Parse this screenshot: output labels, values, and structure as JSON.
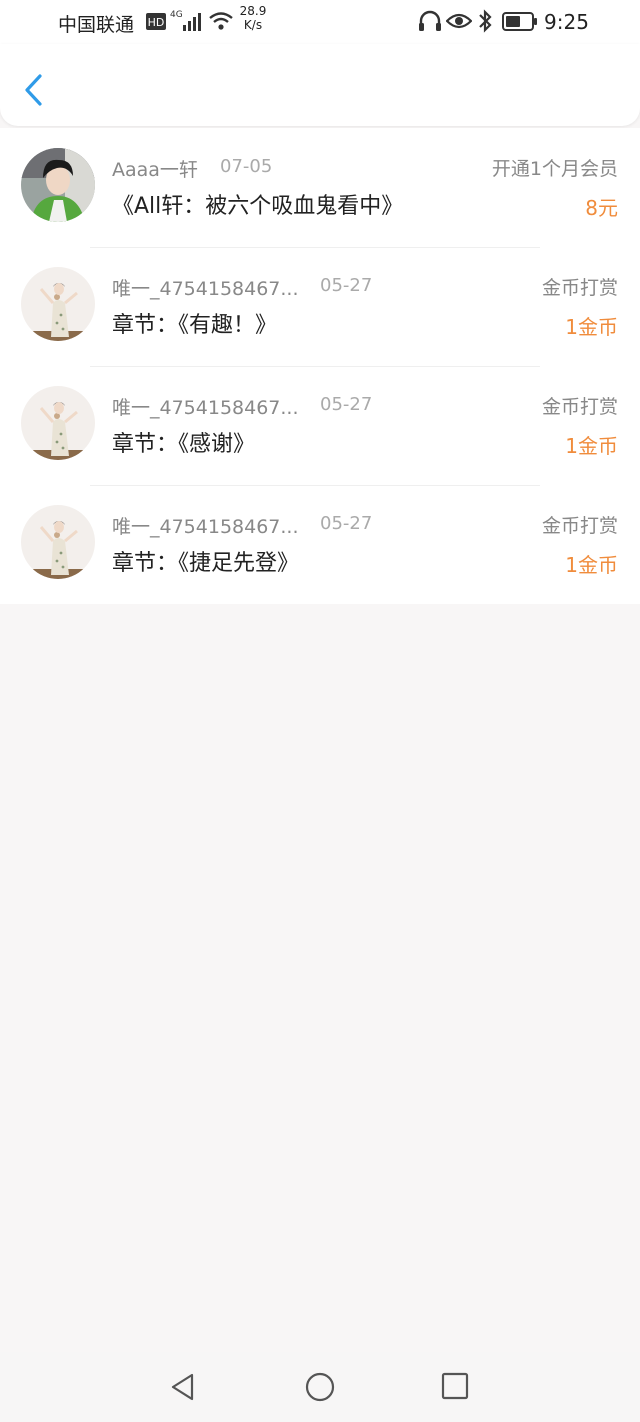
{
  "status_bar": {
    "carrier": "中国联通",
    "hd_badge": "HD",
    "network": "4G",
    "speed_value": "28.9",
    "speed_unit": "K/s",
    "time": "9:25",
    "icons": [
      "signal-icon",
      "wifi-icon",
      "headphones-icon",
      "eye-icon",
      "bluetooth-icon",
      "battery-icon"
    ]
  },
  "header": {
    "back_icon": "chevron-left-icon"
  },
  "records": [
    {
      "name": "Aaaa一轩",
      "date": "07-05",
      "type": "开通1个月会员",
      "description": "《All轩：被六个吸血鬼看中》",
      "amount": "8元",
      "avatar": "photo-boy"
    },
    {
      "name": "唯一_4754158467...",
      "date": "05-27",
      "type": "金币打赏",
      "description": "章节：《有趣！》",
      "amount": "1金币",
      "avatar": "photo-girl"
    },
    {
      "name": "唯一_4754158467...",
      "date": "05-27",
      "type": "金币打赏",
      "description": "章节：《感谢》",
      "amount": "1金币",
      "avatar": "photo-girl"
    },
    {
      "name": "唯一_4754158467...",
      "date": "05-27",
      "type": "金币打赏",
      "description": "章节：《捷足先登》",
      "amount": "1金币",
      "avatar": "photo-girl"
    }
  ],
  "colors": {
    "accent": "#2f9be8",
    "amount": "#f08c3c",
    "background": "#f8f6f6"
  },
  "nav_bar": {
    "buttons": [
      "back-triangle-icon",
      "home-circle-icon",
      "recents-square-icon"
    ]
  }
}
